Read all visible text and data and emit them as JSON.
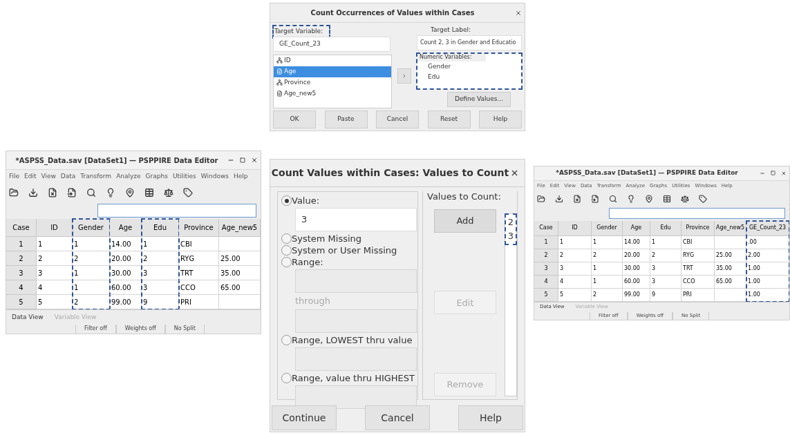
{
  "count_dialog": {
    "title": "Count Occurrences of Values within Cases",
    "target_variable": {
      "label": "Target Variable:",
      "value": "GE_Count_23",
      "highlighted": true
    },
    "target_label": {
      "label": "Target Label:",
      "value": "Count 2, 3 in Gender and Educatio"
    },
    "variables": [
      {
        "name": "ID",
        "kind": "nominal",
        "selected": false
      },
      {
        "name": "Age",
        "kind": "scale",
        "selected": true
      },
      {
        "name": "Province",
        "kind": "nominal",
        "selected": false
      },
      {
        "name": "Age_new5",
        "kind": "scale",
        "selected": false
      }
    ],
    "numeric_variables": {
      "label": "Numeric Variables:",
      "items": [
        "Gender",
        "Edu"
      ],
      "highlighted": true
    },
    "define_values": "Define Values...",
    "buttons": [
      "OK",
      "Paste",
      "Cancel",
      "Reset",
      "Help"
    ]
  },
  "editor_before": {
    "title": "*ASPSS_Data.sav [DataSet1] — PSPPIRE Data Editor",
    "menu": [
      "File",
      "Edit",
      "View",
      "Data",
      "Transform",
      "Analyze",
      "Graphs",
      "Utilities",
      "Windows",
      "Help"
    ],
    "case_header": "Case",
    "cases": [
      "1",
      "2",
      "3",
      "4",
      "5"
    ],
    "columns": [
      {
        "header": "ID",
        "highlighted": false,
        "cells": [
          "1",
          "2",
          "3",
          "4",
          "5"
        ]
      },
      {
        "header": "Gender",
        "highlighted": true,
        "cells": [
          "1",
          "2",
          "1",
          "1",
          "2"
        ]
      },
      {
        "header": "Age",
        "highlighted": false,
        "cells": [
          "14.00",
          "20.00",
          "30.00",
          "60.00",
          "99.00"
        ]
      },
      {
        "header": "Edu",
        "highlighted": true,
        "cells": [
          "1",
          "2",
          "3",
          "3",
          "9"
        ]
      },
      {
        "header": "Province",
        "highlighted": false,
        "cells": [
          "CBI",
          "RYG",
          "TRT",
          "CCO",
          "PRI"
        ]
      },
      {
        "header": "Age_new5",
        "highlighted": false,
        "cells": [
          null,
          "25.00",
          "35.00",
          "65.00",
          null
        ]
      }
    ],
    "tabs": [
      {
        "label": "Data View",
        "selected": true
      },
      {
        "label": "Variable View",
        "selected": false
      }
    ],
    "status": [
      "Filter off",
      "Weights off",
      "No Split"
    ]
  },
  "values_dialog": {
    "title": "Count Values within Cases: Values to Count",
    "options": [
      {
        "kind": "value",
        "label": "Value:",
        "selected": true,
        "value": "3"
      },
      {
        "kind": "plain",
        "label": "System Missing",
        "selected": false
      },
      {
        "kind": "plain",
        "label": "System or User Missing",
        "selected": false
      },
      {
        "kind": "range",
        "label": "Range:",
        "selected": false,
        "through": "through"
      },
      {
        "kind": "bounded",
        "label": "Range, LOWEST thru value",
        "selected": false
      },
      {
        "kind": "bounded",
        "label": "Range, value thru HIGHEST",
        "selected": false
      }
    ],
    "list_label": "Values to Count:",
    "list_buttons": [
      {
        "label": "Add",
        "disabled": false
      },
      {
        "label": "Edit",
        "disabled": true
      },
      {
        "label": "Remove",
        "disabled": true
      }
    ],
    "values": {
      "items": [
        "2",
        "3"
      ],
      "highlighted": true
    },
    "buttons": [
      "Continue",
      "Cancel",
      "Help"
    ]
  },
  "editor_after": {
    "title": "*ASPSS_Data.sav [DataSet1] — PSPPIRE Data Editor",
    "menu": [
      "File",
      "Edit",
      "View",
      "Data",
      "Transform",
      "Analyze",
      "Graphs",
      "Utilities",
      "Windows",
      "Help"
    ],
    "case_header": "Case",
    "cases": [
      "1",
      "2",
      "3",
      "4",
      "5"
    ],
    "columns": [
      {
        "header": "ID",
        "highlighted": false,
        "cells": [
          "1",
          "2",
          "3",
          "4",
          "5"
        ]
      },
      {
        "header": "Gender",
        "highlighted": false,
        "cells": [
          "1",
          "2",
          "1",
          "1",
          "2"
        ]
      },
      {
        "header": "Age",
        "highlighted": false,
        "cells": [
          "14.00",
          "20.00",
          "30.00",
          "60.00",
          "99.00"
        ]
      },
      {
        "header": "Edu",
        "highlighted": false,
        "cells": [
          "1",
          "2",
          "3",
          "3",
          "9"
        ]
      },
      {
        "header": "Province",
        "highlighted": false,
        "cells": [
          "CBI",
          "RYG",
          "TRT",
          "CCO",
          "PRI"
        ]
      },
      {
        "header": "Age_new5",
        "highlighted": false,
        "cells": [
          null,
          "25.00",
          "35.00",
          "65.00",
          null
        ]
      },
      {
        "header": "GE_Count_23",
        "highlighted": true,
        "cells": [
          ".00",
          "2.00",
          "1.00",
          "1.00",
          "1.00"
        ]
      }
    ],
    "tabs": [
      {
        "label": "Data View",
        "selected": true
      },
      {
        "label": "Variable View",
        "selected": false
      }
    ],
    "status": [
      "Filter off",
      "Weights off",
      "No Split"
    ]
  }
}
